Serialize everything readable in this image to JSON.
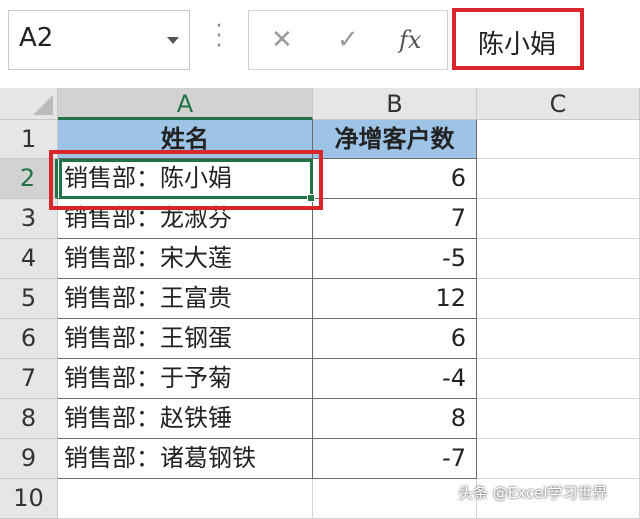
{
  "namebox": {
    "value": "A2"
  },
  "formula": {
    "value": "陈小娟"
  },
  "icons": {
    "cancel": "✕",
    "enter": "✓",
    "fx": "fx"
  },
  "columns": [
    "A",
    "B",
    "C"
  ],
  "rows": [
    "1",
    "2",
    "3",
    "4",
    "5",
    "6",
    "7",
    "8",
    "9",
    "10"
  ],
  "header": {
    "name": "姓名",
    "count": "净增客户数"
  },
  "data": [
    {
      "name": "销售部：陈小娟",
      "count": "6"
    },
    {
      "name": "销售部：龙淑芬",
      "count": "7"
    },
    {
      "name": "销售部：宋大莲",
      "count": "-5"
    },
    {
      "name": "销售部：王富贵",
      "count": "12"
    },
    {
      "name": "销售部：王钢蛋",
      "count": "6"
    },
    {
      "name": "销售部：于予菊",
      "count": "-4"
    },
    {
      "name": "销售部：赵铁锤",
      "count": "8"
    },
    {
      "name": "销售部：诸葛钢铁",
      "count": "-7"
    }
  ],
  "watermark": "头条 @Excel学习世界",
  "colors": {
    "header_fill": "#9dc3e6",
    "selection": "#217346",
    "highlight": "#d9262b"
  }
}
